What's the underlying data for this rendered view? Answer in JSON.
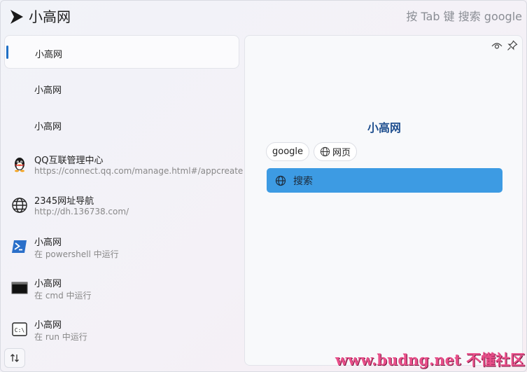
{
  "header": {
    "title": "小高网",
    "search_hint": "按 Tab 键 搜索 google"
  },
  "list": {
    "items": [
      {
        "title": "小高网",
        "subtitle": "",
        "icon": "none",
        "selected": true
      },
      {
        "title": "小高网",
        "subtitle": "",
        "icon": "none",
        "selected": false
      },
      {
        "title": "小高网",
        "subtitle": "",
        "icon": "none",
        "selected": false
      },
      {
        "title": "QQ互联管理中心",
        "subtitle": "https://connect.qq.com/manage.html#/appcreate",
        "icon": "qq-penguin-icon"
      },
      {
        "title": "2345网址导航",
        "subtitle": "http://dh.136738.com/",
        "icon": "globe-icon"
      },
      {
        "title": "小高网",
        "subtitle": "在 powershell 中运行",
        "icon": "powershell-icon"
      },
      {
        "title": "小高网",
        "subtitle": "在 cmd 中运行",
        "icon": "cmd-icon"
      },
      {
        "title": "小高网",
        "subtitle": "在 run 中运行",
        "icon": "run-icon"
      }
    ]
  },
  "preview": {
    "title": "小高网",
    "chips": [
      "google",
      "网页"
    ],
    "action_label": "搜索"
  },
  "watermark": "www.budng.net 不懂社区",
  "colors": {
    "accent": "#1f6fc5",
    "action": "#3d9be3",
    "title": "#1f4f8f"
  }
}
